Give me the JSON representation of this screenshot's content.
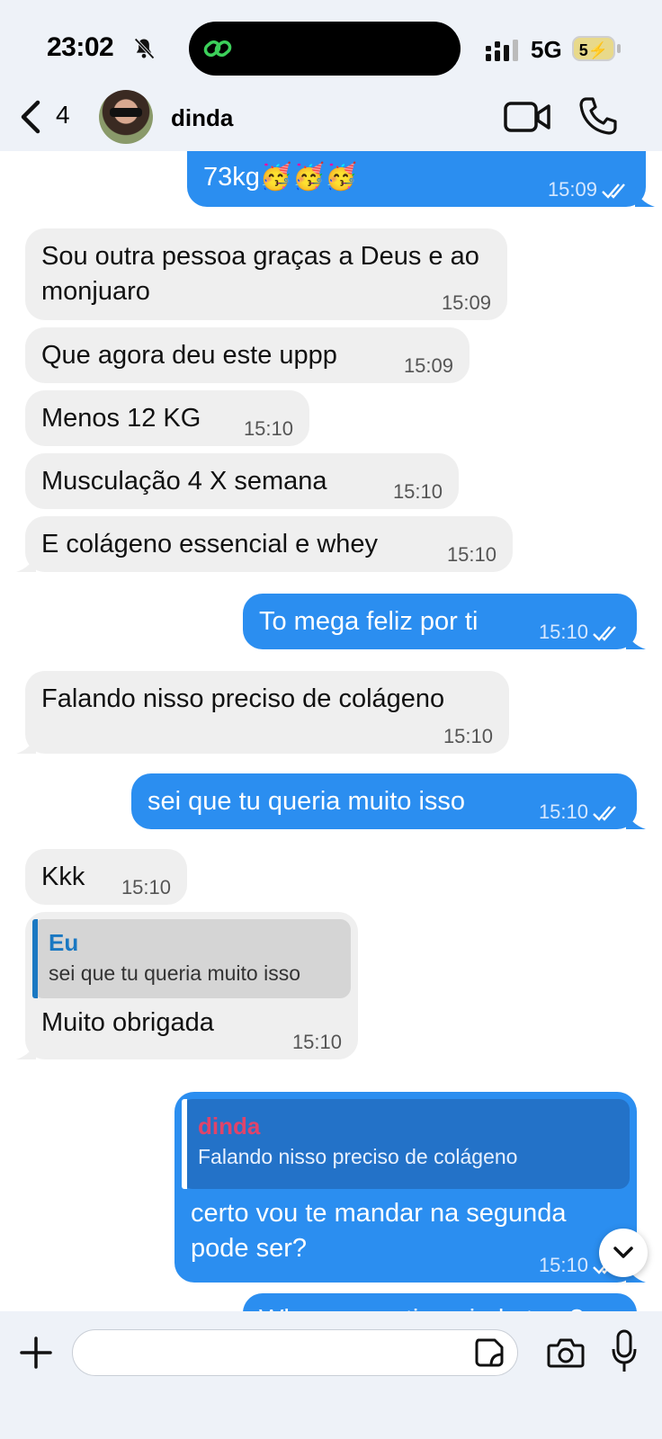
{
  "status_bar": {
    "time": "23:02",
    "network": "5G",
    "battery": "5"
  },
  "header": {
    "back_count": "4",
    "contact_name": "dinda"
  },
  "messages": [
    {
      "direction": "out",
      "text": "73kg🥳🥳🥳",
      "time": "15:09",
      "read": true
    },
    {
      "direction": "in",
      "text": "Sou outra pessoa graças a Deus e ao monjuaro",
      "time": "15:09"
    },
    {
      "direction": "in",
      "text": "Que agora deu este uppp",
      "time": "15:09"
    },
    {
      "direction": "in",
      "text": "Menos 12 KG",
      "time": "15:10"
    },
    {
      "direction": "in",
      "text": "Musculação 4 X semana",
      "time": "15:10"
    },
    {
      "direction": "in",
      "text": "E colágeno essencial e whey",
      "time": "15:10"
    },
    {
      "direction": "out",
      "text": "To mega feliz por ti",
      "time": "15:10",
      "read": true
    },
    {
      "direction": "in",
      "text": "Falando nisso preciso de colágeno",
      "time": "15:10"
    },
    {
      "direction": "out",
      "text": "sei que tu queria muito isso",
      "time": "15:10",
      "read": true
    },
    {
      "direction": "in",
      "text": "Kkk",
      "time": "15:10"
    },
    {
      "direction": "in",
      "reply_name": "Eu",
      "reply_text": "sei que tu queria muito isso",
      "text": "Muito obrigada",
      "time": "15:10"
    },
    {
      "direction": "out",
      "reply_name": "dinda",
      "reply_text": "Falando nisso preciso de colágeno",
      "text": "certo vou te mandar na segunda pode ser?",
      "time": "15:10",
      "read": true
    },
    {
      "direction": "out",
      "text": "Whey e creatina ainda tem?",
      "partial": true
    }
  ],
  "composer": {
    "placeholder": ""
  },
  "colors": {
    "outgoing": "#2b8ef0",
    "incoming": "#efefef",
    "reply_name_in": "#1a78c2",
    "reply_name_out": "#e0446a"
  },
  "icons": [
    "bell-slash-icon",
    "link-icon",
    "signal-icon",
    "back-chevron-icon",
    "video-icon",
    "phone-icon",
    "plus-icon",
    "sticker-icon",
    "camera-icon",
    "microphone-icon",
    "chevron-down-icon",
    "double-check-icon"
  ]
}
